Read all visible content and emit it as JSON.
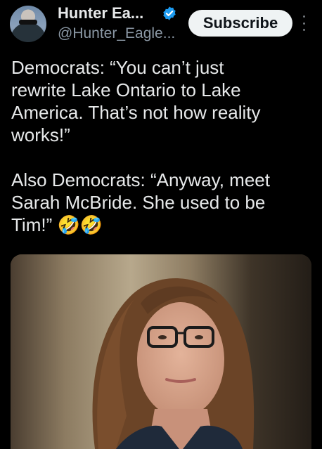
{
  "account": {
    "name": "Hunter Ea...",
    "handle": "@Hunter_Eagle...",
    "verified_color": "#1d9bf0"
  },
  "actions": {
    "subscribe_label": "Subscribe",
    "more_icon": "more-vertical-icon"
  },
  "post": {
    "text": "Democrats: “You can’t just\nrewrite Lake Ontario to Lake\nAmerica. That’s not how reality\nworks!”\n\nAlso Democrats: “Anyway, meet\nSarah McBride. She used to be\nTim!” 🤣🤣"
  },
  "media": {
    "type": "photo"
  }
}
